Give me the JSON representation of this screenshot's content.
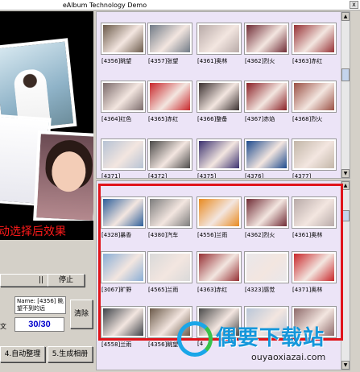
{
  "window": {
    "title": "eAlbum Technology Demo",
    "close_label": "x"
  },
  "preview": {
    "caption": "动选择后效果"
  },
  "controls": {
    "pause_label": "||",
    "stop_label": "停止",
    "name_line1": "Name: [4356] 眺",
    "name_line2": "望不到的远",
    "left_label": "文",
    "counter": "30/30",
    "clear_label": "清除",
    "auto_sort_label": "4.自动整理",
    "make_album_label": "5.生成相册"
  },
  "top_gallery": {
    "items": [
      {
        "label": "[4356]眺望",
        "color": "#6b5a4a"
      },
      {
        "label": "[4357]张望",
        "color": "#707a86"
      },
      {
        "label": "[4361]奥林",
        "color": "#b8aaa8"
      },
      {
        "label": "[4362]烈火",
        "color": "#6f2b35"
      },
      {
        "label": "[4363]赤红",
        "color": "#963034"
      },
      {
        "label": "[4364]红色",
        "color": "#7a6a6a"
      },
      {
        "label": "[4365]赤红",
        "color": "#c8262a"
      },
      {
        "label": "[4366]整备",
        "color": "#3a3030"
      },
      {
        "label": "[4367]赤焰",
        "color": "#8a1f25"
      },
      {
        "label": "[4368]烈火",
        "color": "#9a4f43"
      },
      {
        "label": "[4371]",
        "color": "#b6c2d4"
      },
      {
        "label": "[4372]",
        "color": "#4b4a49"
      },
      {
        "label": "[4375]",
        "color": "#3b3170"
      },
      {
        "label": "[4376]",
        "color": "#1e4b8e"
      },
      {
        "label": "[4377]",
        "color": "#c2b6a8"
      }
    ]
  },
  "bottom_gallery": {
    "items": [
      {
        "label": "[4328]暴香",
        "color": "#2e5f9a"
      },
      {
        "label": "[4380]汽车",
        "color": "#7c7c7c"
      },
      {
        "label": "[4556]兰雨",
        "color": "#e88a20"
      },
      {
        "label": "[4362]烈火",
        "color": "#6f2b35"
      },
      {
        "label": "[4361]奥林",
        "color": "#b8aaa8"
      },
      {
        "label": "[3067]旷野",
        "color": "#8aaed6"
      },
      {
        "label": "[4565]兰雨",
        "color": "#d9d9d9"
      },
      {
        "label": "[4363]赤红",
        "color": "#963034"
      },
      {
        "label": "[4323]感觉",
        "color": "#e9e7ea"
      },
      {
        "label": "[4371]奥林",
        "color": "#c8262a"
      },
      {
        "label": "[4558]兰雨",
        "color": "#3f444a"
      },
      {
        "label": "[4356]眺望",
        "color": "#6b5a4a"
      },
      {
        "label": "[4",
        "color": "#4a4a4a"
      },
      {
        "label": "",
        "color": "#b9c6d8"
      },
      {
        "label": "",
        "color": "#8e6a6a"
      }
    ]
  },
  "watermark": {
    "title": "偶要下载站",
    "url": "ouyaoxiazai.com"
  }
}
